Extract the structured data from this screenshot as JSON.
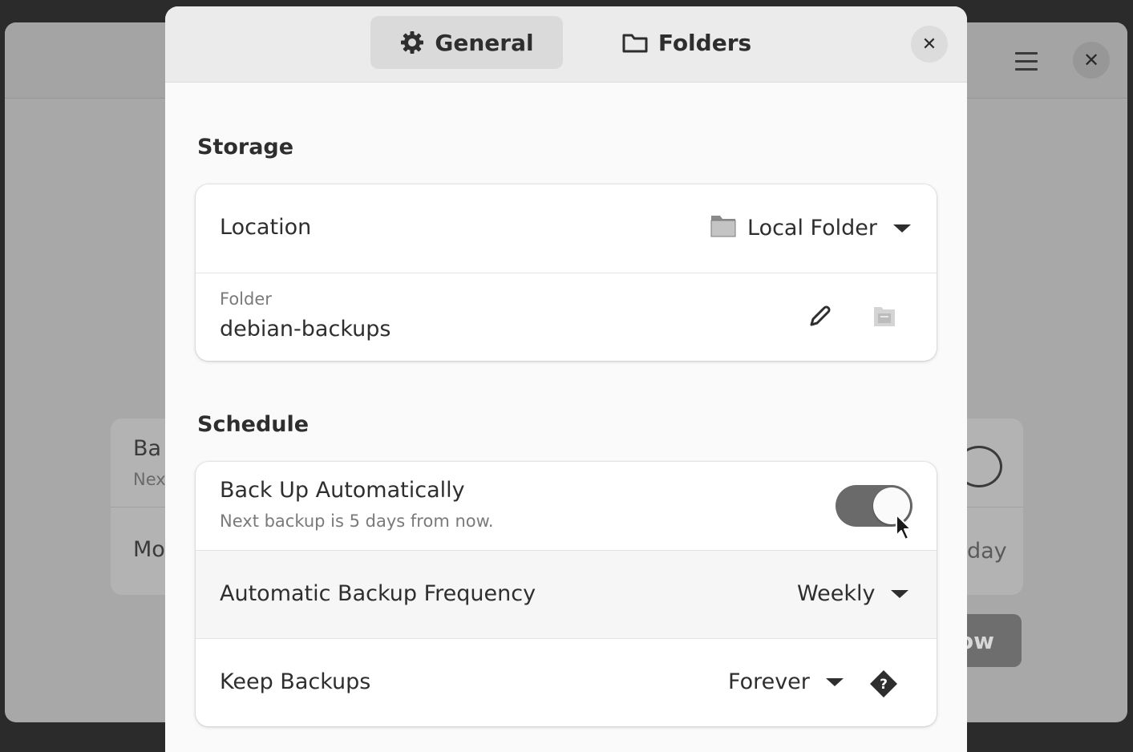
{
  "background_window": {
    "row1_title": "Ba",
    "row1_sub": "Nex",
    "row2_title": "Mo",
    "row2_value": "day",
    "button_label": "ow",
    "icons": [
      "menu-icon",
      "close-icon"
    ]
  },
  "dialog": {
    "tabs": [
      {
        "label": "General",
        "icon": "gear-icon",
        "active": true
      },
      {
        "label": "Folders",
        "icon": "folder-icon",
        "active": false
      }
    ],
    "close_icon": "close-icon",
    "storage": {
      "title": "Storage",
      "location_label": "Location",
      "location_value": "Local Folder",
      "folder_caption": "Folder",
      "folder_value": "debian-backups"
    },
    "schedule": {
      "title": "Schedule",
      "auto_label": "Back Up Automatically",
      "auto_sub": "Next backup is 5 days from now.",
      "auto_enabled": true,
      "frequency_label": "Automatic Backup Frequency",
      "frequency_value": "Weekly",
      "keep_label": "Keep Backups",
      "keep_value": "Forever"
    }
  }
}
